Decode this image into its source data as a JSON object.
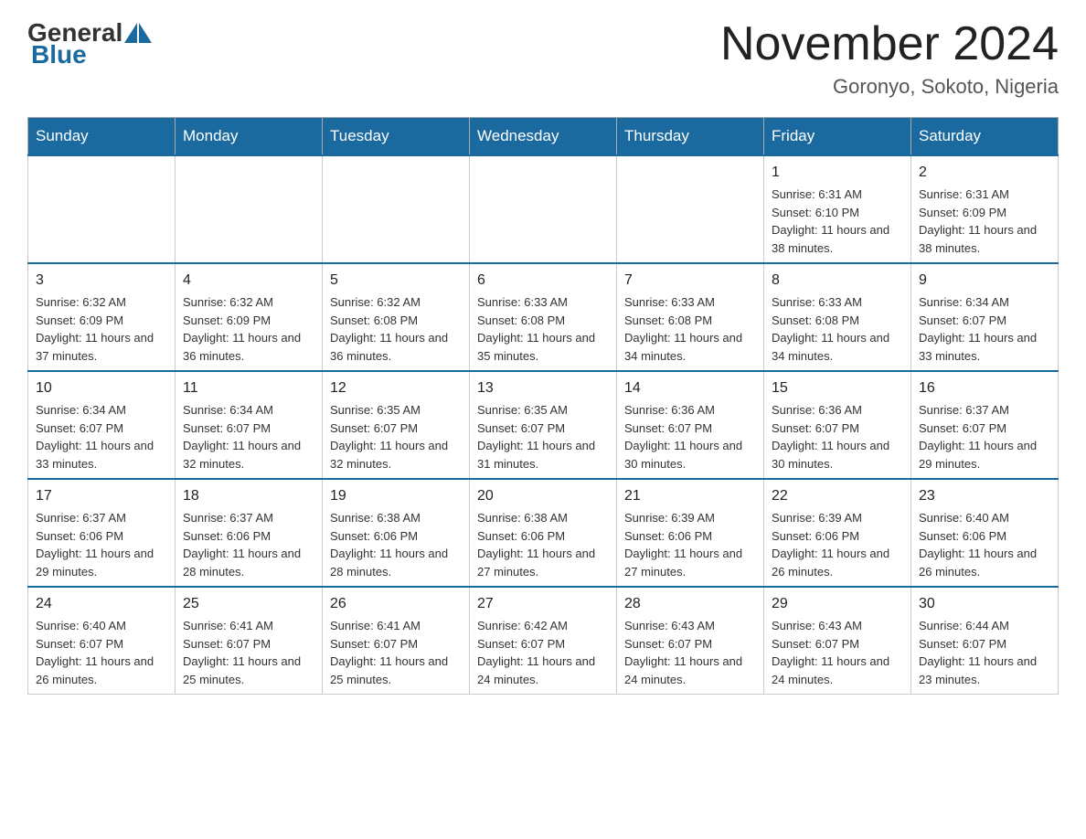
{
  "header": {
    "logo_general": "General",
    "logo_blue": "Blue",
    "month_title": "November 2024",
    "location": "Goronyo, Sokoto, Nigeria"
  },
  "weekdays": [
    "Sunday",
    "Monday",
    "Tuesday",
    "Wednesday",
    "Thursday",
    "Friday",
    "Saturday"
  ],
  "weeks": [
    [
      {
        "day": "",
        "sunrise": "",
        "sunset": "",
        "daylight": ""
      },
      {
        "day": "",
        "sunrise": "",
        "sunset": "",
        "daylight": ""
      },
      {
        "day": "",
        "sunrise": "",
        "sunset": "",
        "daylight": ""
      },
      {
        "day": "",
        "sunrise": "",
        "sunset": "",
        "daylight": ""
      },
      {
        "day": "",
        "sunrise": "",
        "sunset": "",
        "daylight": ""
      },
      {
        "day": "1",
        "sunrise": "Sunrise: 6:31 AM",
        "sunset": "Sunset: 6:10 PM",
        "daylight": "Daylight: 11 hours and 38 minutes."
      },
      {
        "day": "2",
        "sunrise": "Sunrise: 6:31 AM",
        "sunset": "Sunset: 6:09 PM",
        "daylight": "Daylight: 11 hours and 38 minutes."
      }
    ],
    [
      {
        "day": "3",
        "sunrise": "Sunrise: 6:32 AM",
        "sunset": "Sunset: 6:09 PM",
        "daylight": "Daylight: 11 hours and 37 minutes."
      },
      {
        "day": "4",
        "sunrise": "Sunrise: 6:32 AM",
        "sunset": "Sunset: 6:09 PM",
        "daylight": "Daylight: 11 hours and 36 minutes."
      },
      {
        "day": "5",
        "sunrise": "Sunrise: 6:32 AM",
        "sunset": "Sunset: 6:08 PM",
        "daylight": "Daylight: 11 hours and 36 minutes."
      },
      {
        "day": "6",
        "sunrise": "Sunrise: 6:33 AM",
        "sunset": "Sunset: 6:08 PM",
        "daylight": "Daylight: 11 hours and 35 minutes."
      },
      {
        "day": "7",
        "sunrise": "Sunrise: 6:33 AM",
        "sunset": "Sunset: 6:08 PM",
        "daylight": "Daylight: 11 hours and 34 minutes."
      },
      {
        "day": "8",
        "sunrise": "Sunrise: 6:33 AM",
        "sunset": "Sunset: 6:08 PM",
        "daylight": "Daylight: 11 hours and 34 minutes."
      },
      {
        "day": "9",
        "sunrise": "Sunrise: 6:34 AM",
        "sunset": "Sunset: 6:07 PM",
        "daylight": "Daylight: 11 hours and 33 minutes."
      }
    ],
    [
      {
        "day": "10",
        "sunrise": "Sunrise: 6:34 AM",
        "sunset": "Sunset: 6:07 PM",
        "daylight": "Daylight: 11 hours and 33 minutes."
      },
      {
        "day": "11",
        "sunrise": "Sunrise: 6:34 AM",
        "sunset": "Sunset: 6:07 PM",
        "daylight": "Daylight: 11 hours and 32 minutes."
      },
      {
        "day": "12",
        "sunrise": "Sunrise: 6:35 AM",
        "sunset": "Sunset: 6:07 PM",
        "daylight": "Daylight: 11 hours and 32 minutes."
      },
      {
        "day": "13",
        "sunrise": "Sunrise: 6:35 AM",
        "sunset": "Sunset: 6:07 PM",
        "daylight": "Daylight: 11 hours and 31 minutes."
      },
      {
        "day": "14",
        "sunrise": "Sunrise: 6:36 AM",
        "sunset": "Sunset: 6:07 PM",
        "daylight": "Daylight: 11 hours and 30 minutes."
      },
      {
        "day": "15",
        "sunrise": "Sunrise: 6:36 AM",
        "sunset": "Sunset: 6:07 PM",
        "daylight": "Daylight: 11 hours and 30 minutes."
      },
      {
        "day": "16",
        "sunrise": "Sunrise: 6:37 AM",
        "sunset": "Sunset: 6:07 PM",
        "daylight": "Daylight: 11 hours and 29 minutes."
      }
    ],
    [
      {
        "day": "17",
        "sunrise": "Sunrise: 6:37 AM",
        "sunset": "Sunset: 6:06 PM",
        "daylight": "Daylight: 11 hours and 29 minutes."
      },
      {
        "day": "18",
        "sunrise": "Sunrise: 6:37 AM",
        "sunset": "Sunset: 6:06 PM",
        "daylight": "Daylight: 11 hours and 28 minutes."
      },
      {
        "day": "19",
        "sunrise": "Sunrise: 6:38 AM",
        "sunset": "Sunset: 6:06 PM",
        "daylight": "Daylight: 11 hours and 28 minutes."
      },
      {
        "day": "20",
        "sunrise": "Sunrise: 6:38 AM",
        "sunset": "Sunset: 6:06 PM",
        "daylight": "Daylight: 11 hours and 27 minutes."
      },
      {
        "day": "21",
        "sunrise": "Sunrise: 6:39 AM",
        "sunset": "Sunset: 6:06 PM",
        "daylight": "Daylight: 11 hours and 27 minutes."
      },
      {
        "day": "22",
        "sunrise": "Sunrise: 6:39 AM",
        "sunset": "Sunset: 6:06 PM",
        "daylight": "Daylight: 11 hours and 26 minutes."
      },
      {
        "day": "23",
        "sunrise": "Sunrise: 6:40 AM",
        "sunset": "Sunset: 6:06 PM",
        "daylight": "Daylight: 11 hours and 26 minutes."
      }
    ],
    [
      {
        "day": "24",
        "sunrise": "Sunrise: 6:40 AM",
        "sunset": "Sunset: 6:07 PM",
        "daylight": "Daylight: 11 hours and 26 minutes."
      },
      {
        "day": "25",
        "sunrise": "Sunrise: 6:41 AM",
        "sunset": "Sunset: 6:07 PM",
        "daylight": "Daylight: 11 hours and 25 minutes."
      },
      {
        "day": "26",
        "sunrise": "Sunrise: 6:41 AM",
        "sunset": "Sunset: 6:07 PM",
        "daylight": "Daylight: 11 hours and 25 minutes."
      },
      {
        "day": "27",
        "sunrise": "Sunrise: 6:42 AM",
        "sunset": "Sunset: 6:07 PM",
        "daylight": "Daylight: 11 hours and 24 minutes."
      },
      {
        "day": "28",
        "sunrise": "Sunrise: 6:43 AM",
        "sunset": "Sunset: 6:07 PM",
        "daylight": "Daylight: 11 hours and 24 minutes."
      },
      {
        "day": "29",
        "sunrise": "Sunrise: 6:43 AM",
        "sunset": "Sunset: 6:07 PM",
        "daylight": "Daylight: 11 hours and 24 minutes."
      },
      {
        "day": "30",
        "sunrise": "Sunrise: 6:44 AM",
        "sunset": "Sunset: 6:07 PM",
        "daylight": "Daylight: 11 hours and 23 minutes."
      }
    ]
  ]
}
